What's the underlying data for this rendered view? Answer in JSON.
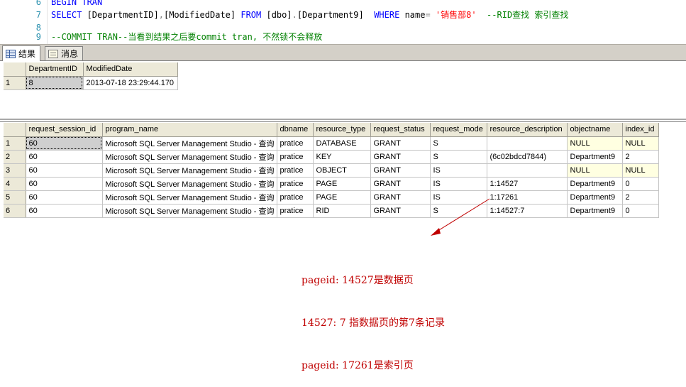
{
  "editor": {
    "lines": [
      {
        "num": "6",
        "segments": [
          {
            "cls": "kw",
            "text": "BEGIN TRAN"
          }
        ]
      },
      {
        "num": "7",
        "segments": [
          {
            "cls": "kw",
            "text": "SELECT "
          },
          {
            "cls": "obj",
            "text": "[DepartmentID]"
          },
          {
            "cls": "gray",
            "text": ","
          },
          {
            "cls": "obj",
            "text": "[ModifiedDate] "
          },
          {
            "cls": "kw",
            "text": "FROM "
          },
          {
            "cls": "obj",
            "text": "[dbo]"
          },
          {
            "cls": "gray",
            "text": "."
          },
          {
            "cls": "obj",
            "text": "[Department9]  "
          },
          {
            "cls": "kw",
            "text": "WHERE "
          },
          {
            "cls": "obj",
            "text": "name"
          },
          {
            "cls": "gray",
            "text": "= "
          },
          {
            "cls": "str",
            "text": "'销售部8'"
          },
          {
            "cls": "cmt",
            "text": "  --RID查找 索引查找"
          }
        ]
      },
      {
        "num": "8",
        "segments": []
      },
      {
        "num": "9",
        "segments": [
          {
            "cls": "cmt",
            "text": "--COMMIT TRAN--当看到结果之后要commit tran, 不然锁不会释放"
          }
        ]
      }
    ]
  },
  "tabs": [
    {
      "label": "结果",
      "icon": "grid-icon",
      "active": true
    },
    {
      "label": "消息",
      "icon": "message-icon",
      "active": false
    }
  ],
  "result1": {
    "columns": [
      "DepartmentID",
      "ModifiedDate"
    ],
    "rows": [
      {
        "n": "1",
        "cells": [
          "8",
          "2013-07-18 23:29:44.170"
        ]
      }
    ]
  },
  "result2": {
    "columns": [
      "request_session_id",
      "program_name",
      "dbname",
      "resource_type",
      "request_status",
      "request_mode",
      "resource_description",
      "objectname",
      "index_id"
    ],
    "rows": [
      {
        "n": "1",
        "cells": [
          "60",
          "Microsoft SQL Server Management Studio - 查询",
          "pratice",
          "DATABASE",
          "GRANT",
          "S",
          "",
          "NULL",
          "NULL"
        ]
      },
      {
        "n": "2",
        "cells": [
          "60",
          "Microsoft SQL Server Management Studio - 查询",
          "pratice",
          "KEY",
          "GRANT",
          "S",
          "(6c02bdcd7844)",
          "Department9",
          "2"
        ]
      },
      {
        "n": "3",
        "cells": [
          "60",
          "Microsoft SQL Server Management Studio - 查询",
          "pratice",
          "OBJECT",
          "GRANT",
          "IS",
          "",
          "NULL",
          "NULL"
        ]
      },
      {
        "n": "4",
        "cells": [
          "60",
          "Microsoft SQL Server Management Studio - 查询",
          "pratice",
          "PAGE",
          "GRANT",
          "IS",
          "1:14527",
          "Department9",
          "0"
        ]
      },
      {
        "n": "5",
        "cells": [
          "60",
          "Microsoft SQL Server Management Studio - 查询",
          "pratice",
          "PAGE",
          "GRANT",
          "IS",
          "1:17261",
          "Department9",
          "2"
        ]
      },
      {
        "n": "6",
        "cells": [
          "60",
          "Microsoft SQL Server Management Studio - 查询",
          "pratice",
          "RID",
          "GRANT",
          "S",
          "1:14527:7",
          "Department9",
          "0"
        ]
      }
    ]
  },
  "annotation": {
    "lines": [
      "pageid: 14527是数据页",
      "14527: 7 指数据页的第7条记录",
      "pageid: 17261是索引页"
    ],
    "color": "#c00000"
  }
}
